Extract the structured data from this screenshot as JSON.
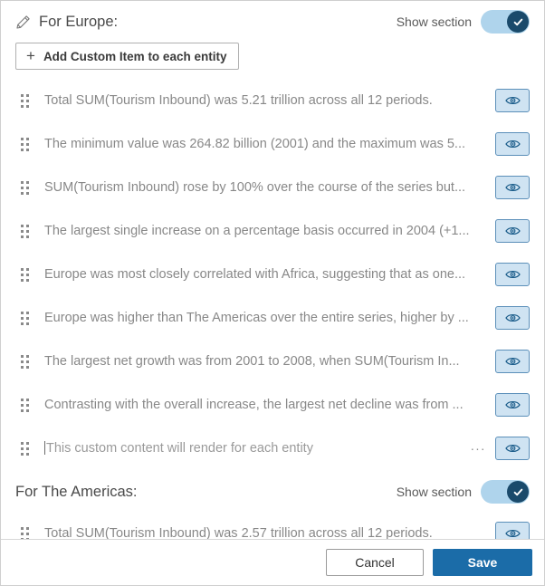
{
  "dialog": {
    "sections": [
      {
        "title": "For Europe:",
        "has_edit_icon": true,
        "edit_icon": "pencil-icon",
        "show_section_label": "Show section",
        "show_section_enabled": true,
        "add_button_label": "Add Custom Item to each entity",
        "add_button_icon": "plus-icon",
        "items": [
          {
            "text": "Total SUM(Tourism Inbound) was 5.21 trillion across all 12 periods.",
            "is_placeholder": false,
            "has_menu": false,
            "visibility_icon": "eye-icon"
          },
          {
            "text": "The minimum value was 264.82 billion (2001) and the maximum was 5...",
            "is_placeholder": false,
            "has_menu": false,
            "visibility_icon": "eye-icon"
          },
          {
            "text": "SUM(Tourism Inbound) rose by 100% over the course of the series but...",
            "is_placeholder": false,
            "has_menu": false,
            "visibility_icon": "eye-icon"
          },
          {
            "text": "The largest single increase on a percentage basis occurred in 2004 (+1...",
            "is_placeholder": false,
            "has_menu": false,
            "visibility_icon": "eye-icon"
          },
          {
            "text": "Europe was most closely correlated with Africa, suggesting that as one...",
            "is_placeholder": false,
            "has_menu": false,
            "visibility_icon": "eye-icon"
          },
          {
            "text": "Europe was higher than The Americas over the entire series, higher by ...",
            "is_placeholder": false,
            "has_menu": false,
            "visibility_icon": "eye-icon"
          },
          {
            "text": "The largest net growth was from 2001 to 2008, when SUM(Tourism In...",
            "is_placeholder": false,
            "has_menu": false,
            "visibility_icon": "eye-icon"
          },
          {
            "text": "Contrasting with the overall increase, the largest net decline was from ...",
            "is_placeholder": false,
            "has_menu": false,
            "visibility_icon": "eye-icon"
          },
          {
            "text": "This custom content will render for each entity",
            "is_placeholder": true,
            "has_menu": true,
            "menu_label": "···",
            "visibility_icon": "eye-icon"
          }
        ]
      },
      {
        "title": "For The Americas:",
        "has_edit_icon": false,
        "show_section_label": "Show section",
        "show_section_enabled": true,
        "items": [
          {
            "text": "Total SUM(Tourism Inbound) was 2.57 trillion across all 12 periods.",
            "is_placeholder": false,
            "has_menu": false,
            "visibility_icon": "eye-icon"
          }
        ]
      }
    ],
    "footer": {
      "cancel_label": "Cancel",
      "save_label": "Save"
    },
    "colors": {
      "accent_blue": "#1b6ca8",
      "toggle_track": "#afd4ec",
      "toggle_knob": "#1a4a6b",
      "eye_button_bg": "#cfe3f2",
      "eye_button_border": "#5b8fb9",
      "row_text": "#888888"
    }
  }
}
